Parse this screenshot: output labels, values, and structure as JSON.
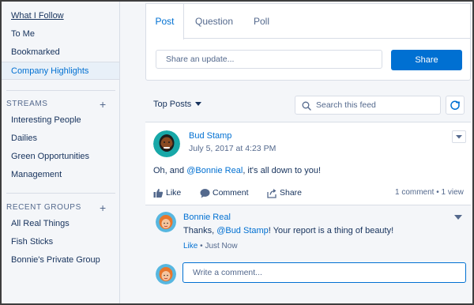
{
  "sidebar": {
    "feeds": [
      {
        "label": "What I Follow"
      },
      {
        "label": "To Me"
      },
      {
        "label": "Bookmarked"
      },
      {
        "label": "Company Highlights"
      }
    ],
    "streams": {
      "header": "STREAMS",
      "add": "+",
      "items": [
        {
          "label": "Interesting People"
        },
        {
          "label": "Dailies"
        },
        {
          "label": "Green Opportunities"
        },
        {
          "label": "Management"
        }
      ]
    },
    "recent_groups": {
      "header": "RECENT GROUPS",
      "add": "+",
      "items": [
        {
          "label": "All Real Things"
        },
        {
          "label": "Fish Sticks"
        },
        {
          "label": "Bonnie's Private Group"
        }
      ]
    }
  },
  "publisher": {
    "tabs": [
      {
        "label": "Post"
      },
      {
        "label": "Question"
      },
      {
        "label": "Poll"
      }
    ],
    "active_tab": "Post",
    "update_placeholder": "Share an update...",
    "share_label": "Share"
  },
  "feed": {
    "sort_label": "Top Posts",
    "search_placeholder": "Search this feed"
  },
  "post": {
    "author": "Bud Stamp",
    "timestamp": "July 5, 2017 at 4:23 PM",
    "body_prefix": "Oh, and ",
    "body_mention": "@Bonnie Real",
    "body_suffix": ", it's all down to you!",
    "actions": {
      "like": "Like",
      "comment": "Comment",
      "share": "Share"
    },
    "comment_count": "1 comment",
    "separator": "•",
    "view_count": "1 view"
  },
  "comment": {
    "author": "Bonnie Real",
    "body_prefix": "Thanks, ",
    "body_mention": "@Bud Stamp",
    "body_suffix": "! Your report is a thing of beauty!",
    "like": "Like",
    "separator": "•",
    "time": "Just Now",
    "write_placeholder": "Write a comment..."
  },
  "colors": {
    "accent": "#0070d2",
    "text": "#16325c",
    "muted": "#54698d",
    "border": "#d8dde6",
    "background": "#f4f6f9"
  }
}
